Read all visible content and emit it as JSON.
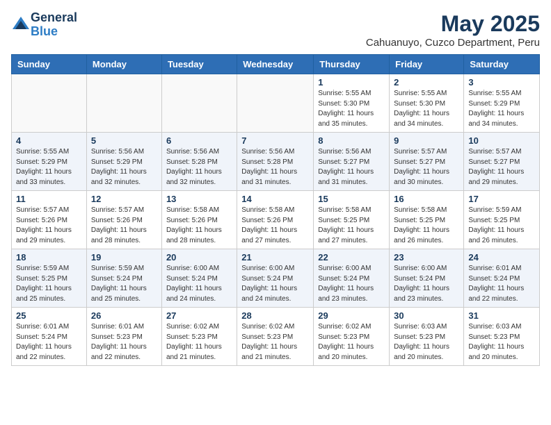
{
  "app": {
    "name_general": "General",
    "name_blue": "Blue"
  },
  "title": {
    "month": "May 2025",
    "location": "Cahuanuyo, Cuzco Department, Peru"
  },
  "days_of_week": [
    "Sunday",
    "Monday",
    "Tuesday",
    "Wednesday",
    "Thursday",
    "Friday",
    "Saturday"
  ],
  "weeks": [
    [
      {
        "day": "",
        "content": ""
      },
      {
        "day": "",
        "content": ""
      },
      {
        "day": "",
        "content": ""
      },
      {
        "day": "",
        "content": ""
      },
      {
        "day": "1",
        "content": "Sunrise: 5:55 AM\nSunset: 5:30 PM\nDaylight: 11 hours\nand 35 minutes."
      },
      {
        "day": "2",
        "content": "Sunrise: 5:55 AM\nSunset: 5:30 PM\nDaylight: 11 hours\nand 34 minutes."
      },
      {
        "day": "3",
        "content": "Sunrise: 5:55 AM\nSunset: 5:29 PM\nDaylight: 11 hours\nand 34 minutes."
      }
    ],
    [
      {
        "day": "4",
        "content": "Sunrise: 5:55 AM\nSunset: 5:29 PM\nDaylight: 11 hours\nand 33 minutes."
      },
      {
        "day": "5",
        "content": "Sunrise: 5:56 AM\nSunset: 5:29 PM\nDaylight: 11 hours\nand 32 minutes."
      },
      {
        "day": "6",
        "content": "Sunrise: 5:56 AM\nSunset: 5:28 PM\nDaylight: 11 hours\nand 32 minutes."
      },
      {
        "day": "7",
        "content": "Sunrise: 5:56 AM\nSunset: 5:28 PM\nDaylight: 11 hours\nand 31 minutes."
      },
      {
        "day": "8",
        "content": "Sunrise: 5:56 AM\nSunset: 5:27 PM\nDaylight: 11 hours\nand 31 minutes."
      },
      {
        "day": "9",
        "content": "Sunrise: 5:57 AM\nSunset: 5:27 PM\nDaylight: 11 hours\nand 30 minutes."
      },
      {
        "day": "10",
        "content": "Sunrise: 5:57 AM\nSunset: 5:27 PM\nDaylight: 11 hours\nand 29 minutes."
      }
    ],
    [
      {
        "day": "11",
        "content": "Sunrise: 5:57 AM\nSunset: 5:26 PM\nDaylight: 11 hours\nand 29 minutes."
      },
      {
        "day": "12",
        "content": "Sunrise: 5:57 AM\nSunset: 5:26 PM\nDaylight: 11 hours\nand 28 minutes."
      },
      {
        "day": "13",
        "content": "Sunrise: 5:58 AM\nSunset: 5:26 PM\nDaylight: 11 hours\nand 28 minutes."
      },
      {
        "day": "14",
        "content": "Sunrise: 5:58 AM\nSunset: 5:26 PM\nDaylight: 11 hours\nand 27 minutes."
      },
      {
        "day": "15",
        "content": "Sunrise: 5:58 AM\nSunset: 5:25 PM\nDaylight: 11 hours\nand 27 minutes."
      },
      {
        "day": "16",
        "content": "Sunrise: 5:58 AM\nSunset: 5:25 PM\nDaylight: 11 hours\nand 26 minutes."
      },
      {
        "day": "17",
        "content": "Sunrise: 5:59 AM\nSunset: 5:25 PM\nDaylight: 11 hours\nand 26 minutes."
      }
    ],
    [
      {
        "day": "18",
        "content": "Sunrise: 5:59 AM\nSunset: 5:25 PM\nDaylight: 11 hours\nand 25 minutes."
      },
      {
        "day": "19",
        "content": "Sunrise: 5:59 AM\nSunset: 5:24 PM\nDaylight: 11 hours\nand 25 minutes."
      },
      {
        "day": "20",
        "content": "Sunrise: 6:00 AM\nSunset: 5:24 PM\nDaylight: 11 hours\nand 24 minutes."
      },
      {
        "day": "21",
        "content": "Sunrise: 6:00 AM\nSunset: 5:24 PM\nDaylight: 11 hours\nand 24 minutes."
      },
      {
        "day": "22",
        "content": "Sunrise: 6:00 AM\nSunset: 5:24 PM\nDaylight: 11 hours\nand 23 minutes."
      },
      {
        "day": "23",
        "content": "Sunrise: 6:00 AM\nSunset: 5:24 PM\nDaylight: 11 hours\nand 23 minutes."
      },
      {
        "day": "24",
        "content": "Sunrise: 6:01 AM\nSunset: 5:24 PM\nDaylight: 11 hours\nand 22 minutes."
      }
    ],
    [
      {
        "day": "25",
        "content": "Sunrise: 6:01 AM\nSunset: 5:24 PM\nDaylight: 11 hours\nand 22 minutes."
      },
      {
        "day": "26",
        "content": "Sunrise: 6:01 AM\nSunset: 5:23 PM\nDaylight: 11 hours\nand 22 minutes."
      },
      {
        "day": "27",
        "content": "Sunrise: 6:02 AM\nSunset: 5:23 PM\nDaylight: 11 hours\nand 21 minutes."
      },
      {
        "day": "28",
        "content": "Sunrise: 6:02 AM\nSunset: 5:23 PM\nDaylight: 11 hours\nand 21 minutes."
      },
      {
        "day": "29",
        "content": "Sunrise: 6:02 AM\nSunset: 5:23 PM\nDaylight: 11 hours\nand 20 minutes."
      },
      {
        "day": "30",
        "content": "Sunrise: 6:03 AM\nSunset: 5:23 PM\nDaylight: 11 hours\nand 20 minutes."
      },
      {
        "day": "31",
        "content": "Sunrise: 6:03 AM\nSunset: 5:23 PM\nDaylight: 11 hours\nand 20 minutes."
      }
    ]
  ]
}
